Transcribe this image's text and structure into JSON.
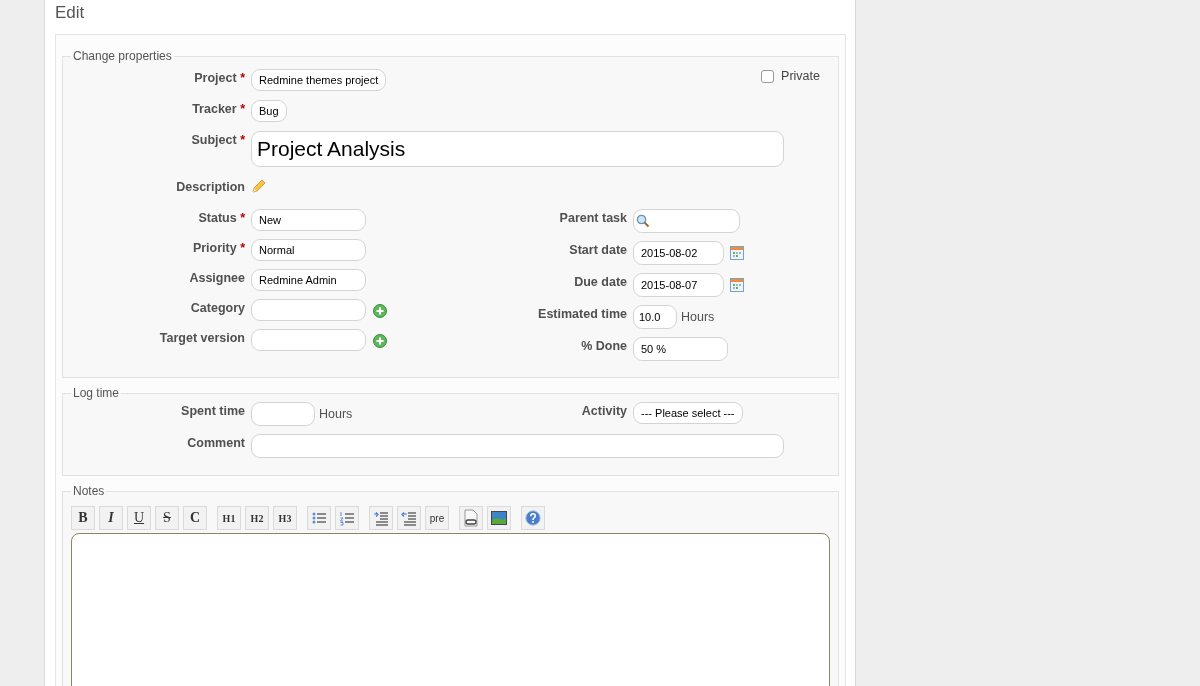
{
  "page": {
    "title": "Edit"
  },
  "properties": {
    "legend": "Change properties",
    "required_mark": "*",
    "top_fields": [
      {
        "label": "Project",
        "required": true,
        "value": "Redmine themes project",
        "kind": "select"
      },
      {
        "label": "Tracker",
        "required": true,
        "value": "Bug",
        "kind": "select"
      },
      {
        "label": "Subject",
        "required": true,
        "value": "Project Analysis",
        "kind": "subject"
      }
    ],
    "private": {
      "label": "Private",
      "checked": false
    },
    "description": {
      "label": "Description"
    },
    "left_fields": [
      {
        "label": "Status",
        "required": true,
        "value": "New",
        "kind": "select"
      },
      {
        "label": "Priority",
        "required": true,
        "value": "Normal",
        "kind": "select"
      },
      {
        "label": "Assignee",
        "required": false,
        "value": "Redmine Admin",
        "kind": "select"
      },
      {
        "label": "Category",
        "required": false,
        "kind": "select_add"
      },
      {
        "label": "Target version",
        "required": false,
        "kind": "select_add"
      }
    ],
    "right_fields": [
      {
        "label": "Parent task",
        "kind": "search"
      },
      {
        "label": "Start date",
        "value": "2015-08-02",
        "kind": "date"
      },
      {
        "label": "Due date",
        "value": "2015-08-07",
        "kind": "date"
      },
      {
        "label": "Estimated time",
        "value": "10.0",
        "unit": "Hours",
        "kind": "number"
      },
      {
        "label": "% Done",
        "value": "50 %",
        "kind": "percent"
      }
    ]
  },
  "log_time": {
    "legend": "Log time",
    "spent_time": {
      "label": "Spent time",
      "unit": "Hours"
    },
    "activity": {
      "label": "Activity",
      "value": "--- Please select ---"
    },
    "comment": {
      "label": "Comment"
    }
  },
  "notes": {
    "legend": "Notes",
    "toolbar_groups": [
      [
        {
          "kind": "bold",
          "label": "B"
        },
        {
          "kind": "italic",
          "label": "I"
        },
        {
          "kind": "underline",
          "label": "U"
        },
        {
          "kind": "strike",
          "label": "S"
        },
        {
          "kind": "code",
          "label": "C"
        }
      ],
      [
        {
          "kind": "h1",
          "label": "H1"
        },
        {
          "kind": "h2",
          "label": "H2"
        },
        {
          "kind": "h3",
          "label": "H3"
        }
      ],
      [
        {
          "kind": "ul"
        },
        {
          "kind": "ol"
        }
      ],
      [
        {
          "kind": "indent"
        },
        {
          "kind": "outdent"
        },
        {
          "kind": "pre",
          "label": "pre"
        }
      ],
      [
        {
          "kind": "link"
        },
        {
          "kind": "image"
        }
      ],
      [
        {
          "kind": "help"
        }
      ]
    ]
  }
}
